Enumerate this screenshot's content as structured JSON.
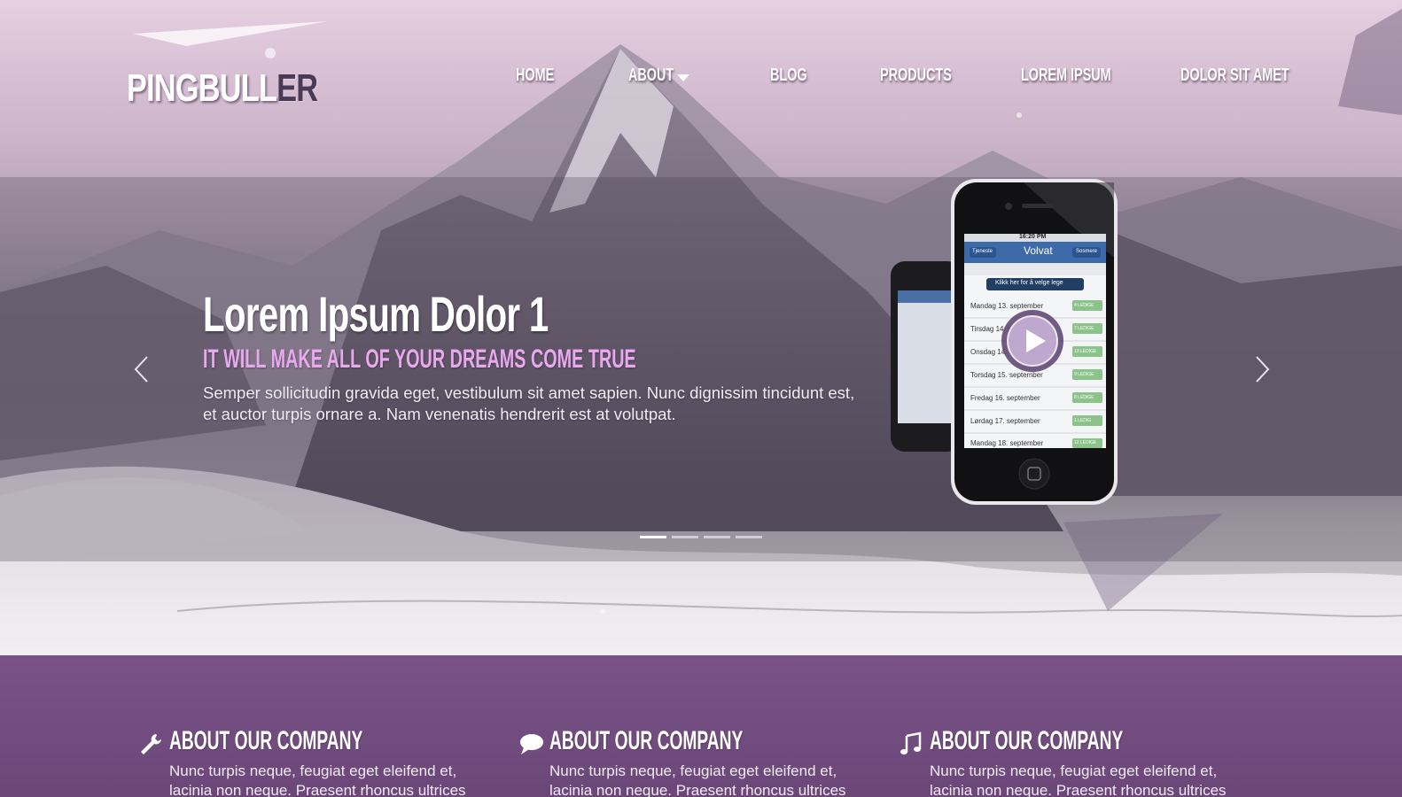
{
  "header": {
    "logo_main": "PINGBULL",
    "logo_accent": "ER",
    "nav": [
      {
        "label": "HOME"
      },
      {
        "label": "ABOUT"
      },
      {
        "label": "BLOG"
      },
      {
        "label": "PRODUCTS"
      },
      {
        "label": "LOREM IPSUM"
      },
      {
        "label": "DOLOR SIT AMET"
      }
    ]
  },
  "slider": {
    "title": "Lorem Ipsum Dolor 1",
    "subtitle": "IT WILL MAKE ALL OF YOUR DREAMS COME TRUE",
    "text": "Semper sollicitudin gravida eget, vestibulum sit amet sapien. Nunc dignissim tincidunt est, et auctor turpis ornare a. Nam venenatis hendrerit est at volutpat.",
    "active_slide": 1,
    "slide_count": 4
  },
  "phone": {
    "time": "16:20 PM",
    "app_name": "Volvat",
    "back_label": "Tjeneste",
    "right_label": "Sosmere",
    "button_label": "Klikk her for å velge lege",
    "rows": [
      {
        "day": "Mandag 13. september",
        "badge": "4 LEDIGE"
      },
      {
        "day": "Tirsdag 14. september",
        "badge": "7 LEDIGE"
      },
      {
        "day": "Onsdag 14. september",
        "badge": "13 LEDIGE"
      },
      {
        "day": "Torsdag 15. september",
        "badge": "9 LEDIGE"
      },
      {
        "day": "Fredag 16. september",
        "badge": "8 LEDIGE"
      },
      {
        "day": "Lørdag 17. september",
        "badge": "1 LEDIG"
      },
      {
        "day": "Mandag 18. september",
        "badge": "12 LEDIGE"
      }
    ]
  },
  "features": [
    {
      "icon": "wrench-icon",
      "title": "ABOUT OUR COMPANY",
      "text_line1": "Nunc turpis neque, feugiat eget eleifend et,",
      "text_line2": "lacinia non neque. Praesent rhoncus ultrices"
    },
    {
      "icon": "speech-bubble-icon",
      "title": "ABOUT OUR COMPANY",
      "text_line1": "Nunc turpis neque, feugiat eget eleifend et,",
      "text_line2": "lacinia non neque. Praesent rhoncus ultrices"
    },
    {
      "icon": "music-note-icon",
      "title": "ABOUT OUR COMPANY",
      "text_line1": "Nunc turpis neque, feugiat eget eleifend et,",
      "text_line2": "lacinia non neque. Praesent rhoncus ultrices"
    }
  ],
  "colors": {
    "accent_pink": "#e9a8ef",
    "section_purple": "#74508a",
    "badge_green": "#8cc38a"
  }
}
